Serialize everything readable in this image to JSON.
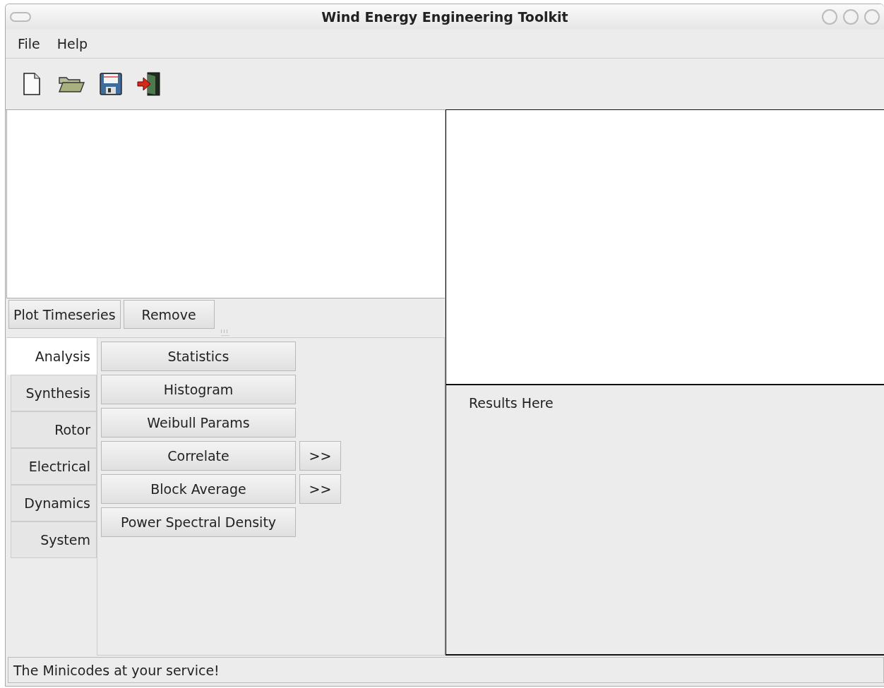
{
  "window": {
    "title": "Wind Energy Engineering Toolkit"
  },
  "menu": [
    "File",
    "Help"
  ],
  "series_buttons": [
    "Plot Timeseries",
    "Remove"
  ],
  "tabs": [
    {
      "label": "Analysis",
      "selected": true
    },
    {
      "label": "Synthesis",
      "selected": false
    },
    {
      "label": "Rotor",
      "selected": false
    },
    {
      "label": "Electrical",
      "selected": false
    },
    {
      "label": "Dynamics",
      "selected": false
    },
    {
      "label": "System",
      "selected": false
    }
  ],
  "analysis_buttons": [
    {
      "label": "Statistics"
    },
    {
      "label": "Histogram"
    },
    {
      "label": "Weibull Params"
    },
    {
      "label": "Correlate",
      "extra": ">>"
    },
    {
      "label": "Block Average",
      "extra": ">>"
    },
    {
      "label": "Power Spectral Density"
    }
  ],
  "results": "Results Here",
  "status_bar": "The Minicodes at your service!"
}
